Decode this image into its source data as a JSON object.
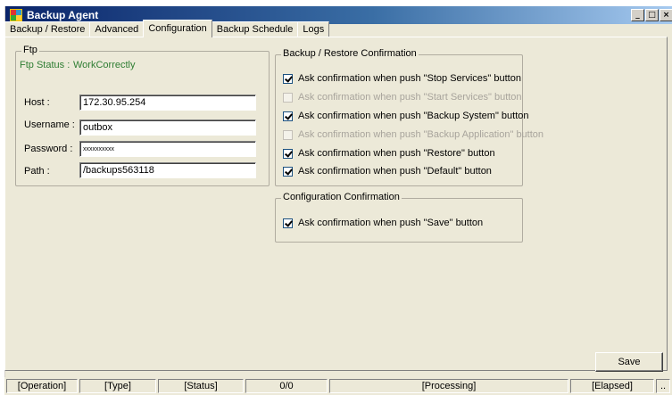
{
  "window": {
    "title": "Backup Agent",
    "controls": {
      "minimize": "_",
      "maximize": "□",
      "close": "×"
    }
  },
  "tabs": [
    {
      "label": "Backup / Restore"
    },
    {
      "label": "Advanced"
    },
    {
      "label": "Configuration",
      "active": true
    },
    {
      "label": "Backup Schedule"
    },
    {
      "label": "Logs"
    }
  ],
  "ftp": {
    "group_title": "Ftp",
    "status_label": "Ftp Status :",
    "status_value": "WorkCorrectly",
    "status_color": "#2e7d32",
    "host_label": "Host :",
    "host_value": "172.30.95.254",
    "username_label": "Username :",
    "username_value": "outbox",
    "password_label": "Password :",
    "password_value": "xxxxxxxxxx",
    "path_label": "Path :",
    "path_value": "/backups563118"
  },
  "backup_restore_confirmation": {
    "group_title": "Backup / Restore Confirmation",
    "items": [
      {
        "label": "Ask confirmation when push \"Stop Services\" button",
        "checked": true,
        "enabled": true
      },
      {
        "label": "Ask confirmation when push \"Start Services\" button",
        "checked": false,
        "enabled": false
      },
      {
        "label": "Ask confirmation when push \"Backup System\" button",
        "checked": true,
        "enabled": true
      },
      {
        "label": "Ask confirmation when push \"Backup Application\" button",
        "checked": false,
        "enabled": false
      },
      {
        "label": "Ask confirmation when push \"Restore\" button",
        "checked": true,
        "enabled": true
      },
      {
        "label": "Ask confirmation when push \"Default\" button",
        "checked": true,
        "enabled": true
      }
    ]
  },
  "configuration_confirmation": {
    "group_title": "Configuration Confirmation",
    "items": [
      {
        "label": "Ask confirmation when push \"Save\" button",
        "checked": true,
        "enabled": true
      }
    ]
  },
  "save_label": "Save",
  "statusbar": {
    "operation": "[Operation]",
    "type": "[Type]",
    "status": "[Status]",
    "count": "0/0",
    "processing": "[Processing]",
    "elapsed": "[Elapsed]",
    "extra": ".."
  }
}
